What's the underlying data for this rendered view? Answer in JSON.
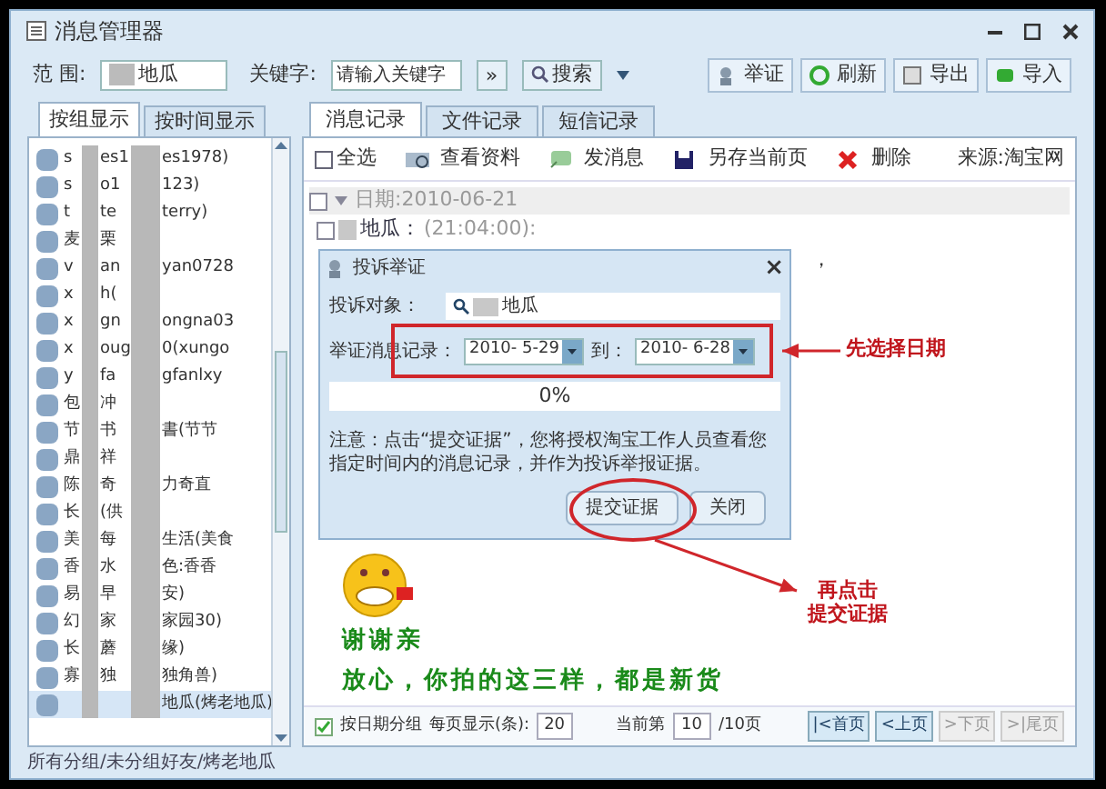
{
  "window": {
    "title": "消息管理器"
  },
  "toolbar": {
    "range_label": "范 围:",
    "range_value": "地瓜",
    "keyword_label": "关键字:",
    "keyword_placeholder": "请输入关键字",
    "expand": "»",
    "search": "搜索",
    "buttons": [
      "举证",
      "刷新",
      "导出",
      "导入"
    ]
  },
  "left_tabs": [
    {
      "label": "按组显示",
      "selected": true
    },
    {
      "label": "按时间显示",
      "selected": false
    }
  ],
  "contacts": [
    {
      "prefix": "s",
      "middle": "es1",
      "suffix": "es1978)",
      "selected": false
    },
    {
      "prefix": "s",
      "middle": "o1",
      "suffix": "123)",
      "selected": false
    },
    {
      "prefix": "t",
      "middle": "te",
      "suffix": "terry)",
      "selected": false
    },
    {
      "prefix": "麦",
      "middle": "栗",
      "selected": false
    },
    {
      "prefix": "v",
      "middle": "an",
      "suffix": "yan0728",
      "selected": false
    },
    {
      "prefix": "x",
      "middle": "h(",
      "selected": false
    },
    {
      "prefix": "x",
      "middle": "gn",
      "suffix": "ongna03",
      "selected": false
    },
    {
      "prefix": "x",
      "middle": "oug",
      "suffix": "0(xungo",
      "selected": false
    },
    {
      "prefix": "y",
      "middle": "fa",
      "suffix": "gfanlxy",
      "selected": false
    },
    {
      "prefix": "包",
      "middle": "冲",
      "selected": false
    },
    {
      "prefix": "节",
      "middle": "书",
      "suffix": "書(节节",
      "selected": false
    },
    {
      "prefix": "鼎",
      "middle": "祥",
      "selected": false
    },
    {
      "prefix": "陈",
      "middle": "奇",
      "suffix": "力奇直",
      "selected": false
    },
    {
      "prefix": "长",
      "middle": "(供",
      "selected": false
    },
    {
      "prefix": "美",
      "middle": "每",
      "suffix": "生活(美食",
      "selected": false
    },
    {
      "prefix": "香",
      "middle": "水",
      "suffix": "色:香香",
      "selected": false
    },
    {
      "prefix": "易",
      "middle": "早",
      "suffix": "安)",
      "selected": false
    },
    {
      "prefix": "幻",
      "middle": "家",
      "suffix": "家园30)",
      "selected": false
    },
    {
      "prefix": "长",
      "middle": "蘑",
      "suffix": "缘)",
      "selected": false
    },
    {
      "prefix": "寡",
      "middle": "独",
      "suffix": "独角兽)",
      "selected": false
    },
    {
      "suffix": "地瓜(烤老地瓜)",
      "selected": true
    }
  ],
  "right_tabs": [
    {
      "label": "消息记录",
      "selected": true
    },
    {
      "label": "文件记录",
      "selected": false
    },
    {
      "label": "短信记录",
      "selected": false
    }
  ],
  "actions": [
    {
      "kind": "checkbox",
      "label": "全选",
      "checked": false
    },
    {
      "kind": "profile",
      "label": "查看资料"
    },
    {
      "kind": "message",
      "label": "发消息"
    },
    {
      "kind": "save",
      "label": "另存当前页"
    },
    {
      "kind": "delete",
      "label": "删除"
    }
  ],
  "source": "来源:淘宝网",
  "date_group": {
    "label": "日期:2010-06-21",
    "checked": false
  },
  "message": {
    "checked": false,
    "sender": "地瓜：",
    "time": "(21:04:00):",
    "trailing": "，"
  },
  "message_body": [
    "谢谢亲",
    "放心，你拍的这三样，都是新货"
  ],
  "dialog": {
    "title": "投诉举证",
    "close": "×",
    "target_label": "投诉对象：",
    "target_value": "地瓜",
    "range_label": "举证消息记录：",
    "from": "2010- 5-29",
    "to_label": "到：",
    "to": "2010- 6-28",
    "progress": {
      "level": 0,
      "reading": "0%"
    },
    "note": "注意：点击“提交证据”，您将授权淘宝工作人员查看您指定时间内的消息记录，并作为投诉举报证据。",
    "buttons": [
      "提交证据",
      "关闭"
    ]
  },
  "annotations": [
    {
      "lines": [
        "先选择日期"
      ]
    },
    {
      "lines": [
        "再点击",
        "提交证据"
      ]
    }
  ],
  "pager": {
    "group_label": "按日期分组",
    "group_checked": true,
    "per_page_label": "每页显示(条):",
    "per_page": "20",
    "current_label": "当前第",
    "current": "10",
    "total": "/10页",
    "buttons": [
      {
        "label": "|<首页",
        "disabled": false
      },
      {
        "label": "<上页",
        "disabled": false
      },
      {
        "label": ">下页",
        "disabled": true
      },
      {
        "label": ">|尾页",
        "disabled": true
      }
    ]
  },
  "status_bar": "所有分组/未分组好友/烤老地瓜"
}
